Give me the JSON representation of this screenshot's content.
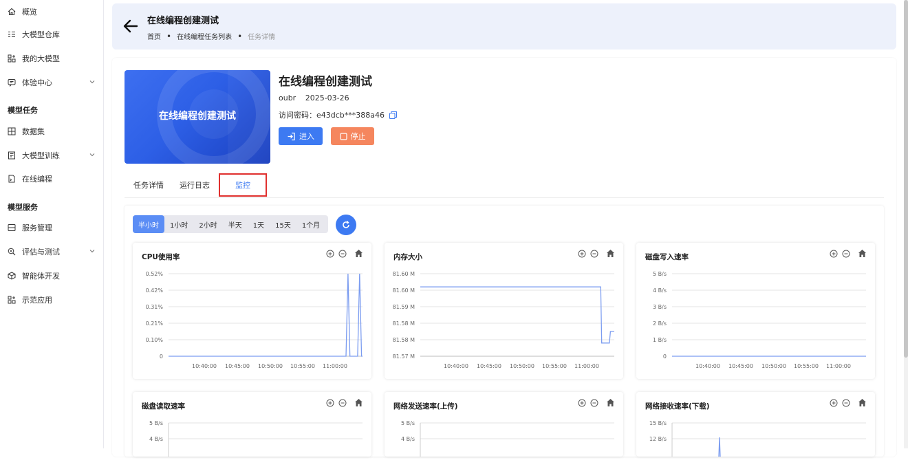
{
  "sidebar": {
    "items": [
      {
        "label": "概览",
        "icon": "home-icon",
        "top": 6,
        "chev": false
      },
      {
        "label": "大模型仓库",
        "icon": "list-icon",
        "top": 39,
        "chev": false
      },
      {
        "label": "我的大模型",
        "icon": "grid-plus-icon",
        "top": 74,
        "chev": false
      },
      {
        "label": "体验中心",
        "icon": "chat-icon",
        "top": 109,
        "chev": true
      }
    ],
    "group_tasks": "模型任务",
    "task_items": [
      {
        "label": "数据集",
        "icon": "table-icon"
      },
      {
        "label": "大模型训练",
        "icon": "train-icon",
        "chev": true
      },
      {
        "label": "在线编程",
        "icon": "code-icon"
      }
    ],
    "group_services": "模型服务",
    "service_items": [
      {
        "label": "服务管理",
        "icon": "server-icon"
      },
      {
        "label": "评估与测试",
        "icon": "zoom-icon",
        "chev": true
      },
      {
        "label": "智能体开发",
        "icon": "cube-icon"
      },
      {
        "label": "示范应用",
        "icon": "apps-icon"
      }
    ]
  },
  "header": {
    "title": "在线编程创建测试",
    "breadcrumb": [
      "首页",
      "在线编程任务列表",
      "任务详情"
    ]
  },
  "task": {
    "cover_text": "在线编程创建测试",
    "title": "在线编程创建测试",
    "user": "oubr",
    "date": "2025-03-26",
    "password_label": "访问密码：",
    "password": "e43dcb***388a46",
    "enter_label": "进入",
    "stop_label": "停止"
  },
  "tabs": [
    "任务详情",
    "运行日志",
    "监控"
  ],
  "active_tab": 2,
  "time_ranges": [
    "半小时",
    "1小时",
    "2小时",
    "半天",
    "1天",
    "15天",
    "1个月"
  ],
  "active_range": 0,
  "colors": {
    "accent": "#3d7af2",
    "stop": "#f5865e",
    "line": "#7b9cf0"
  },
  "charts": [
    {
      "title": "CPU使用率",
      "yticks": [
        "0",
        "0.10%",
        "0.21%",
        "0.31%",
        "0.42%",
        "0.52%"
      ],
      "xticks": [
        "10:40:00",
        "10:45:00",
        "10:50:00",
        "10:55:00",
        "11:00:00"
      ]
    },
    {
      "title": "内存大小",
      "yticks": [
        "81.57 M",
        "81.58 M",
        "81.58 M",
        "81.59 M",
        "81.60 M",
        "81.60 M"
      ],
      "xticks": [
        "10:40:00",
        "10:45:00",
        "10:50:00",
        "10:55:00",
        "11:00:00"
      ]
    },
    {
      "title": "磁盘写入速率",
      "yticks": [
        "0",
        "1 B/s",
        "2 B/s",
        "3 B/s",
        "4 B/s",
        "5 B/s"
      ],
      "xticks": [
        "10:40:00",
        "10:45:00",
        "10:50:00",
        "10:55:00",
        "11:00:00"
      ]
    },
    {
      "title": "磁盘读取速率",
      "yticks": [
        "4 B/s",
        "5 B/s"
      ],
      "xticks": []
    },
    {
      "title": "网络发送速率(上传)",
      "yticks": [
        "4 B/s",
        "5 B/s"
      ],
      "xticks": []
    },
    {
      "title": "网络接收速率(下载)",
      "yticks": [
        "12 B/s",
        "15 B/s"
      ],
      "xticks": []
    }
  ]
}
